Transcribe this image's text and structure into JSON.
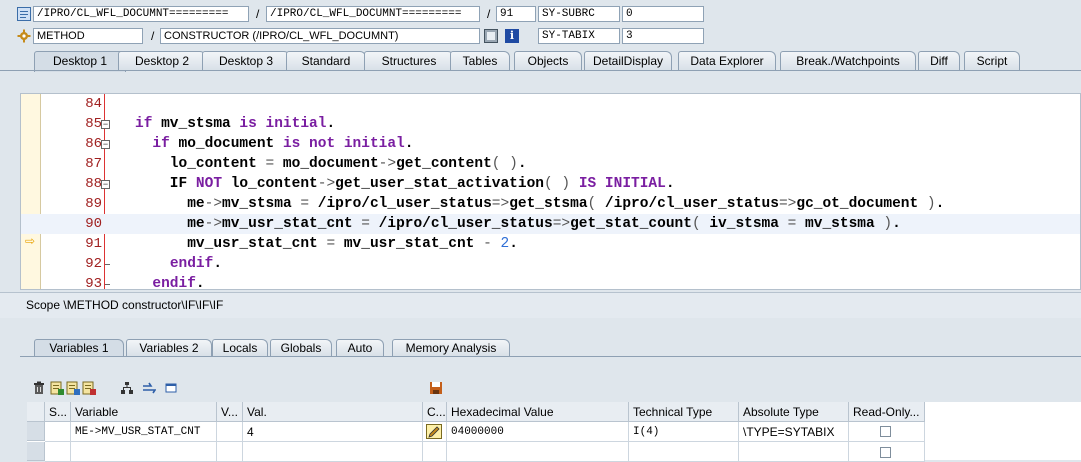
{
  "header": {
    "program_1": "/IPRO/CL_WFL_DOCUMNT=========",
    "slash_1": "/",
    "program_2": "/IPRO/CL_WFL_DOCUMNT=========",
    "slash_2": "/",
    "line_no": "91",
    "sysvar_1_name": "SY-SUBRC",
    "sysvar_1_value": "0",
    "event_type": "METHOD",
    "slash_3": "/",
    "event_name": "CONSTRUCTOR (/IPRO/CL_WFL_DOCUMNT)",
    "sysvar_2_name": "SY-TABIX",
    "sysvar_2_value": "3"
  },
  "tabs": [
    "Desktop 1",
    "Desktop 2",
    "Desktop 3",
    "Standard",
    "Structures",
    "Tables",
    "Objects",
    "DetailDisplay",
    "Data Explorer",
    "Break./Watchpoints",
    "Diff",
    "Script"
  ],
  "active_tab": "Desktop 1",
  "code_lines": [
    {
      "num": "84",
      "text": ""
    },
    {
      "num": "85",
      "text": "if mv_stsma is initial."
    },
    {
      "num": "86",
      "text": "  if mo_document is not initial."
    },
    {
      "num": "87",
      "text": "    lo_content = mo_document->get_content( )."
    },
    {
      "num": "88",
      "text": "    IF NOT lo_content->get_user_stat_activation( ) IS INITIAL."
    },
    {
      "num": "89",
      "text": "      me->mv_stsma = /ipro/cl_user_status=>get_stsma( /ipro/cl_user_status=>gc_ot_document )."
    },
    {
      "num": "90",
      "text": "      me->mv_usr_stat_cnt = /ipro/cl_user_status=>get_stat_count( iv_stsma = mv_stsma )."
    },
    {
      "num": "91",
      "text": "      mv_usr_stat_cnt = mv_usr_stat_cnt - 2."
    },
    {
      "num": "92",
      "text": "    endif."
    },
    {
      "num": "93",
      "text": "  endif."
    }
  ],
  "current_line": "91",
  "scope": "Scope \\METHOD constructor\\IF\\IF\\IF",
  "var_tabs": [
    "Variables 1",
    "Variables 2",
    "Locals",
    "Globals",
    "Auto",
    "Memory Analysis"
  ],
  "active_var_tab": "Variables 1",
  "grid": {
    "headers": [
      "S...",
      "Variable",
      "V...",
      "Val.",
      "C...",
      "Hexadecimal Value",
      "Technical Type",
      "Absolute Type",
      "Read-Only..."
    ],
    "rows": [
      {
        "variable": "ME->MV_USR_STAT_CNT",
        "value": "4",
        "hex": "04000000",
        "tech_type": "I(4)",
        "abs_type": "\\TYPE=SYTABIX",
        "readonly": false
      },
      {
        "variable": "",
        "value": "",
        "hex": "",
        "tech_type": "",
        "abs_type": "",
        "readonly": false
      }
    ]
  },
  "colors": {
    "keyword": "#7a1ea1",
    "number": "#2f6fd6",
    "line_number": "#a02020",
    "arrow": "#e9a100"
  }
}
